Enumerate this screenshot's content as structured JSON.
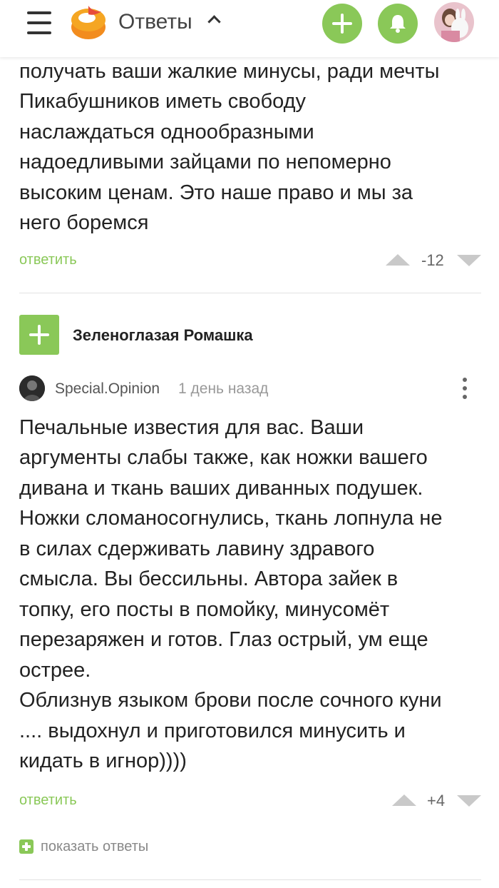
{
  "header": {
    "title": "Ответы",
    "icons": [
      "menu-icon",
      "pikabu-logo",
      "chevron-up-icon",
      "plus-icon",
      "bell-icon",
      "avatar"
    ],
    "accent": "#8ac858"
  },
  "comment1": {
    "lines": [
      "получать ваши жалкие минусы, ради мечты",
      "Пикабушников иметь свободу",
      "наслаждаться однообразными",
      "надоедливыми зайцами по непомерно",
      "высоким ценам. Это наше право и мы за",
      "него боремся"
    ],
    "reply_label": "ответить",
    "rating": "-12"
  },
  "thread": {
    "username": "Зеленоглазая Ромашка"
  },
  "comment2": {
    "author": "Special.Opinion",
    "time": "1 день назад",
    "lines": [
      "Печальные известия для вас. Ваши",
      "аргументы слабы также, как ножки вашего",
      "дивана и ткань ваших диванных подушек.",
      "Ножки сломаносогнулись, ткань лопнула не",
      "в силах сдерживать лавину здравого",
      "смысла. Вы бессильны. Автора зайек в",
      "топку, его посты в помойку, минусомёт",
      "перезаряжен и готов. Глаз острый, ум еще",
      "острее.",
      "Облизнув языком брови после сочного куни",
      ".... выдохнул и приготовился минусить и",
      "кидать в игнор))))"
    ],
    "reply_label": "ответить",
    "rating": "+4",
    "show_replies": "показать ответы"
  }
}
